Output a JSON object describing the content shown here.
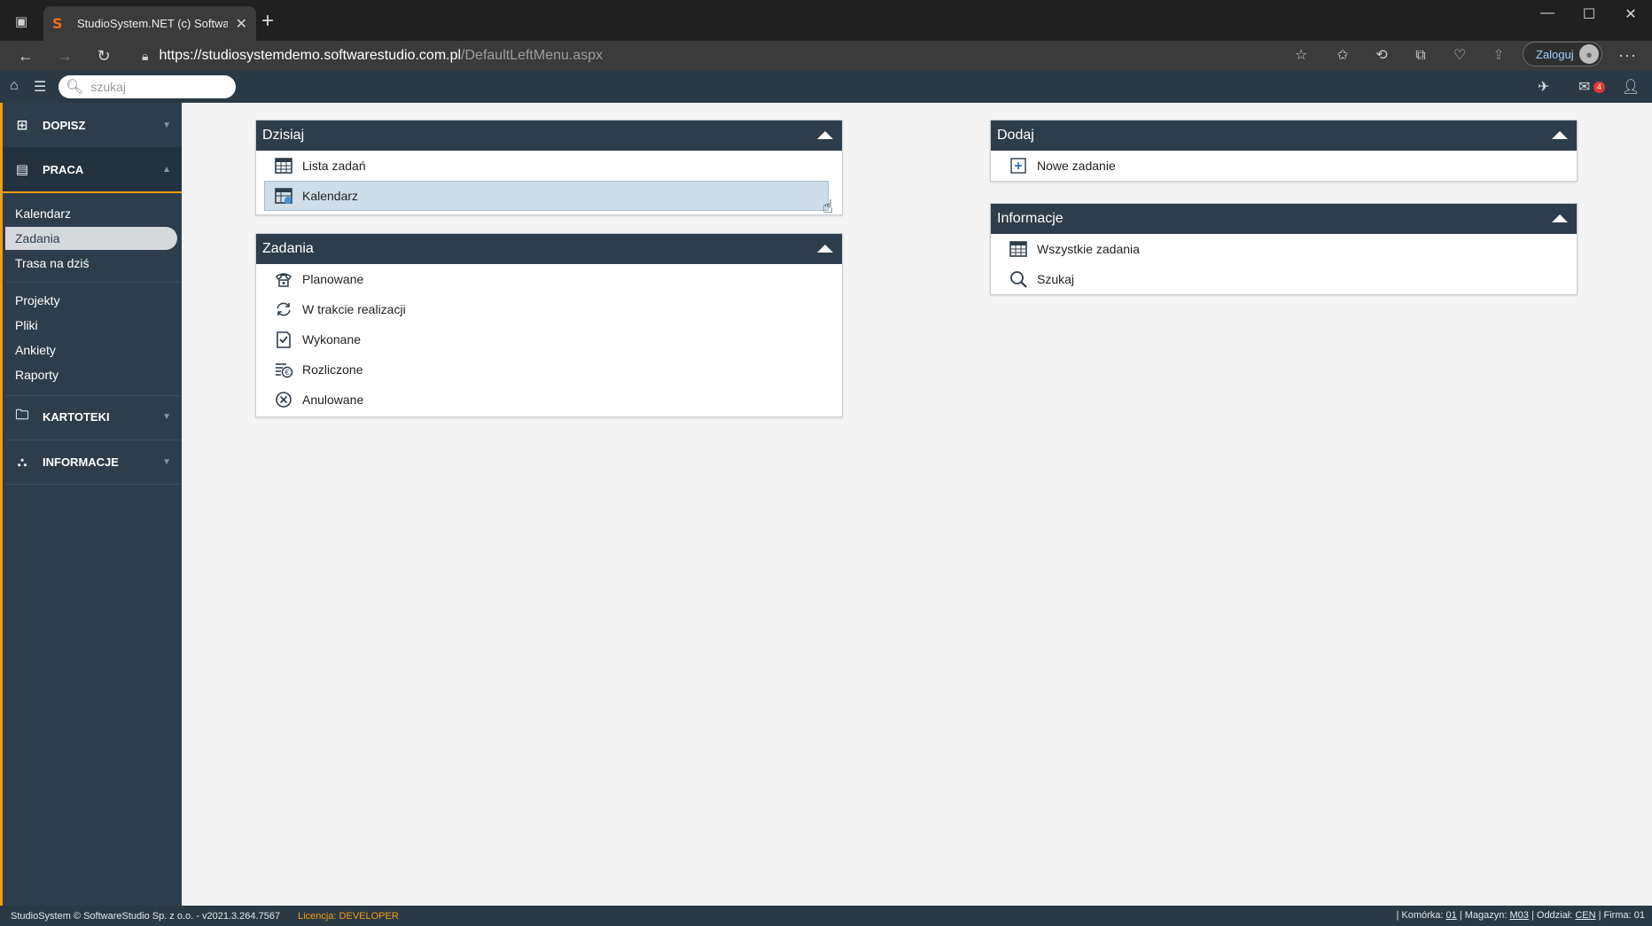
{
  "browser": {
    "tab_title": "StudioSystem.NET (c) SoftwareSt",
    "url_host": "https://studiosystemdemo.softwarestudio.com.pl",
    "url_path": "/DefaultLeftMenu.aspx",
    "login_label": "Zaloguj"
  },
  "header": {
    "search_placeholder": "szukaj",
    "mail_count": "4"
  },
  "sidebar": {
    "sections": [
      {
        "label": "DOPISZ",
        "icon": "plus-square-icon"
      },
      {
        "label": "PRACA",
        "icon": "document-icon"
      },
      {
        "label": "KARTOTEKI",
        "icon": "folder-icon"
      },
      {
        "label": "INFORMACJE",
        "icon": "sitemap-icon"
      }
    ],
    "praca_items": [
      "Kalendarz",
      "Zadania",
      "Trasa na dziś"
    ],
    "other_items": [
      "Projekty",
      "Pliki",
      "Ankiety",
      "Raporty"
    ],
    "selected": "Zadania"
  },
  "panels": {
    "dzisiaj": {
      "title": "Dzisiaj",
      "items": [
        {
          "label": "Lista zadań",
          "icon": "task-list-icon"
        },
        {
          "label": "Kalendarz",
          "icon": "calendar-icon"
        }
      ]
    },
    "zadania": {
      "title": "Zadania",
      "items": [
        {
          "label": "Planowane",
          "icon": "phone-icon"
        },
        {
          "label": "W trakcie realizacji",
          "icon": "refresh-icon"
        },
        {
          "label": "Wykonane",
          "icon": "checked-document-icon"
        },
        {
          "label": "Rozliczone",
          "icon": "settled-icon"
        },
        {
          "label": "Anulowane",
          "icon": "cancel-icon"
        }
      ]
    },
    "dodaj": {
      "title": "Dodaj",
      "items": [
        {
          "label": "Nowe zadanie",
          "icon": "add-task-icon"
        }
      ]
    },
    "informacje": {
      "title": "Informacje",
      "items": [
        {
          "label": "Wszystkie zadania",
          "icon": "task-list-icon"
        },
        {
          "label": "Szukaj",
          "icon": "search-icon"
        }
      ]
    }
  },
  "statusbar": {
    "copyright": "StudioSystem © SoftwareStudio Sp. z o.o. - v2021.3.264.7567",
    "licence": "Licencja: DEVELOPER",
    "komorka_label": "| Komórka:",
    "komorka": "01",
    "magazyn_label": "| Magazyn:",
    "magazyn": "M03",
    "oddzial_label": "| Oddział:",
    "oddzial": "CEN",
    "firma_label": "| Firma:",
    "firma": "01"
  },
  "colors": {
    "sidebar_bg": "#2e3d4b",
    "accent": "#f39c12",
    "panel_header": "#2e3d4b",
    "hover_item": "#cfdde9"
  }
}
